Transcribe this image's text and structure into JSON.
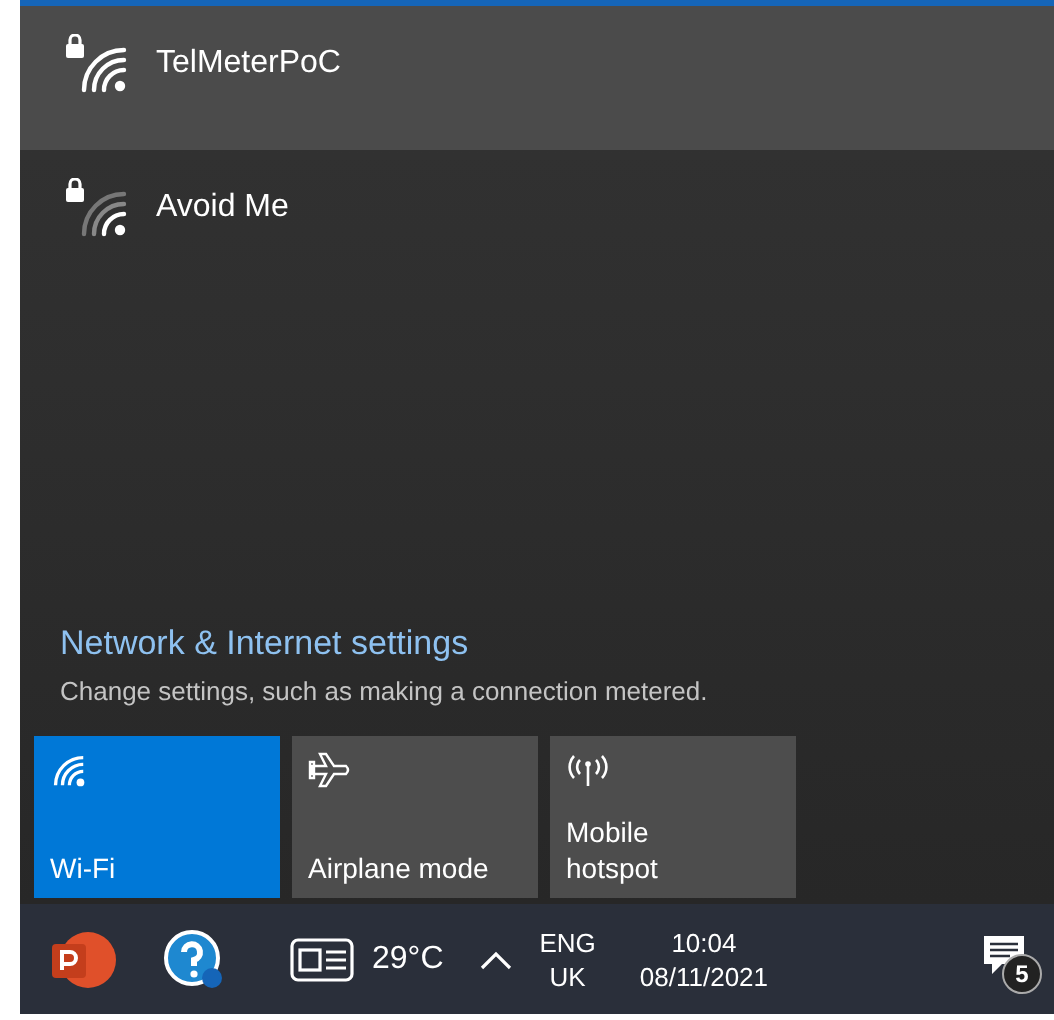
{
  "networks": [
    {
      "name": "TelMeterPoC",
      "secured": true,
      "selected": true
    },
    {
      "name": "Avoid Me",
      "secured": true,
      "selected": false
    }
  ],
  "settings": {
    "link": "Network & Internet settings",
    "description": "Change settings, such as making a connection metered."
  },
  "quick_actions": [
    {
      "kind": "wifi",
      "lines": [
        "Wi-Fi"
      ],
      "on": true
    },
    {
      "kind": "airplane",
      "lines": [
        "Airplane mode"
      ],
      "on": false
    },
    {
      "kind": "hotspot",
      "lines": [
        "Mobile",
        "hotspot"
      ],
      "on": false
    }
  ],
  "taskbar": {
    "temperature": "29°C",
    "language": [
      "ENG",
      "UK"
    ],
    "time": "10:04",
    "date": "08/11/2021",
    "notification_count": "5"
  }
}
